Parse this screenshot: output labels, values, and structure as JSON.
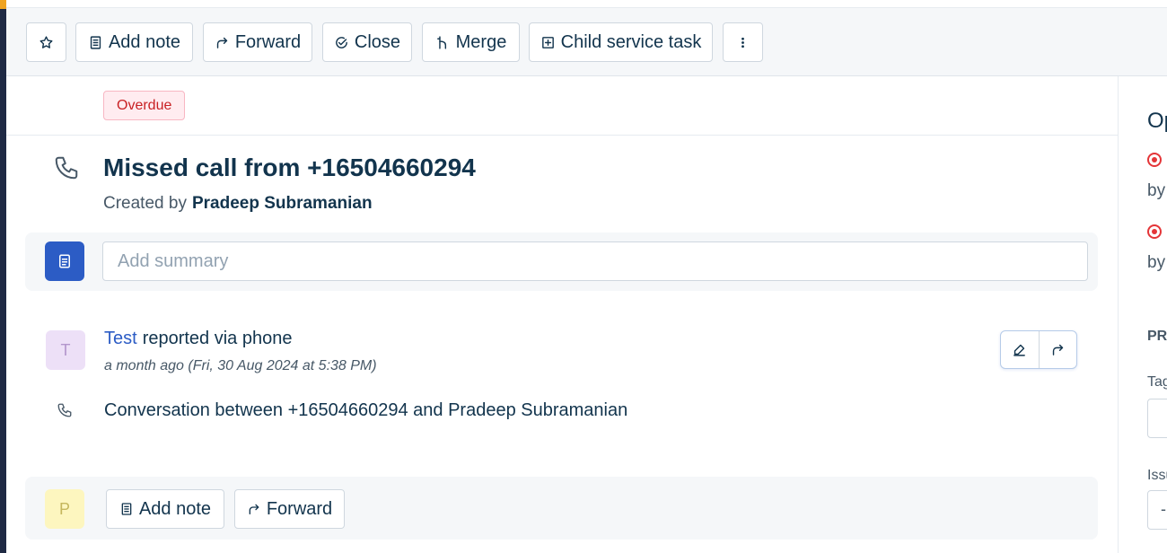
{
  "toolbar": {
    "add_note": "Add note",
    "forward": "Forward",
    "close": "Close",
    "merge": "Merge",
    "child_task": "Child service task"
  },
  "status": {
    "badge": "Overdue",
    "badge_color": "#c82124"
  },
  "ticket": {
    "title": "Missed call from +16504660294",
    "created_prefix": "Created by",
    "created_by": "Pradeep Subramanian"
  },
  "summary": {
    "placeholder": "Add summary"
  },
  "message": {
    "avatar_letter": "T",
    "author": "Test",
    "via": "reported via phone",
    "time": "a month ago (Fri, 30 Aug 2024 at 5:38 PM)",
    "conversation": "Conversation between +16504660294 and Pradeep Subramanian"
  },
  "reply": {
    "avatar_letter": "P",
    "add_note": "Add note",
    "forward": "Forward"
  },
  "right_panel": {
    "heading": "Op",
    "by1": "by",
    "by2": "by",
    "section": "PR",
    "tags_label": "Tag",
    "issue_label": "Issu",
    "issue_value": "-"
  },
  "colors": {
    "accent": "#2c5cc5",
    "alert": "#e43538"
  }
}
